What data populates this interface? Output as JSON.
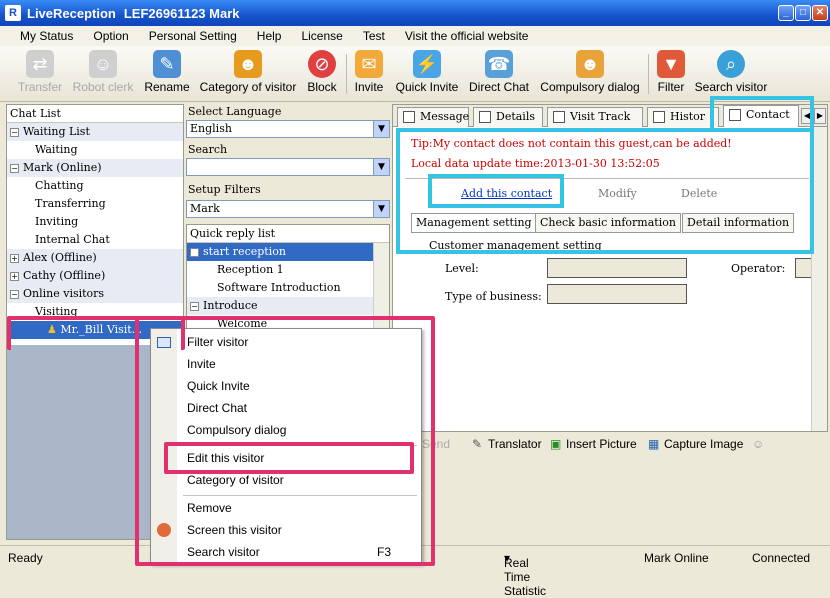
{
  "window": {
    "app_name": "LiveReception",
    "title": "LEF26961123 Mark",
    "app_icon_letter": "R"
  },
  "menu": [
    "My Status",
    "Option",
    "Personal Setting",
    "Help",
    "License",
    "Test",
    "Visit the official website"
  ],
  "toolbar": {
    "transfer": "Transfer",
    "robot_clerk": "Robot clerk",
    "rename": "Rename",
    "category": "Category of visitor",
    "block": "Block",
    "invite": "Invite",
    "quick_invite": "Quick Invite",
    "direct_chat": "Direct Chat",
    "compulsory": "Compulsory dialog",
    "filter": "Filter",
    "search": "Search visitor"
  },
  "chat_list": {
    "header": "Chat List",
    "items": [
      "Waiting List",
      "Waiting",
      "Mark (Online)",
      "Chatting",
      "Transferring",
      "Inviting",
      "Internal Chat",
      "Alex (Offline)",
      "Cathy (Offline)",
      "Online visitors",
      "Visiting",
      "Mr._Bill Visit..."
    ]
  },
  "middle": {
    "select_language_label": "Select Language",
    "language": "English",
    "search_label": "Search",
    "search_value": "",
    "setup_filters_label": "Setup Filters",
    "filter": "Mark",
    "quick_reply_header": "Quick reply list",
    "quick_reply": [
      "start reception",
      "Reception 1",
      "Software Introduction",
      "Introduce",
      "Welcome"
    ]
  },
  "tabs": [
    "Message",
    "Details",
    "Visit Track",
    "Histor",
    "Contact"
  ],
  "contact": {
    "tip": "Tip:My contact does not contain this guest,can be added!",
    "update": "Local data update time:2013-01-30 13:52:05",
    "add": "Add this contact",
    "modify": "Modify",
    "delete": "Delete",
    "subtabs": [
      "Management setting",
      "Check basic information",
      "Detail information"
    ],
    "section": "Customer management setting",
    "level_label": "Level:",
    "operator_label": "Operator:",
    "business_label": "Type of business:"
  },
  "bottom": {
    "send": "Send",
    "translator": "Translator",
    "insert_picture": "Insert Picture",
    "capture_image": "Capture Image"
  },
  "status": {
    "ready": "Ready",
    "realtime": "Real Time Statistic",
    "user": "Mark Online",
    "connection": "Connected"
  },
  "context_menu": {
    "items": [
      "Filter visitor",
      "Invite",
      "Quick Invite",
      "Direct Chat",
      "Compulsory dialog",
      "Edit this visitor",
      "Category of visitor",
      "Remove",
      "Screen this visitor",
      "Search visitor"
    ],
    "shortcut": "F3"
  },
  "colors": {
    "title_blue": "#1553cc",
    "highlight_pink": "#e0306e",
    "highlight_cyan": "#37c3e3",
    "tip_red": "#d00000"
  }
}
